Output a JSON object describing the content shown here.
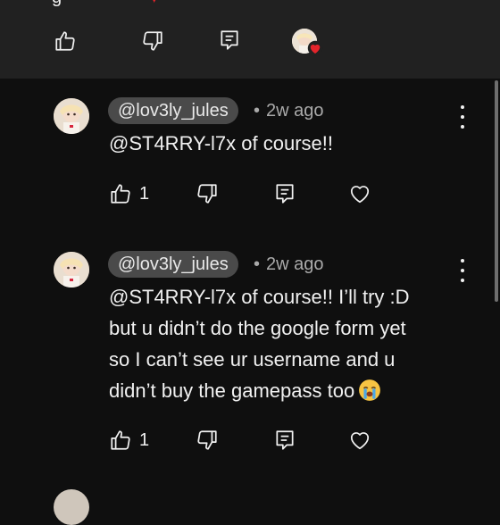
{
  "top": {
    "partial_text": "g",
    "heart_fragment": "♥"
  },
  "comments": [
    {
      "handle": "@lov3ly_jules",
      "separator": "•",
      "time": "2w ago",
      "text": "@ST4RRY-l7x of course!!",
      "likes": "1"
    },
    {
      "handle": "@lov3ly_jules",
      "separator": "•",
      "time": "2w ago",
      "text_lines": [
        "@ST4RRY-l7x of course!! I’ll try :D",
        "but u didn’t do the google form yet",
        "so I can’t see ur username and u",
        "didn’t buy the gamepass too"
      ],
      "emoji": "loudly-crying-face",
      "likes": "1"
    }
  ],
  "icons": {
    "like": "thumbs-up-icon",
    "dislike": "thumbs-down-icon",
    "reply": "reply-icon",
    "heart": "heart-icon",
    "more": "more-vert-icon"
  },
  "colors": {
    "background": "#0f0f0f",
    "top_panel": "#212121",
    "pill": "#4a4a4a",
    "creator_heart": "#e3242b"
  }
}
